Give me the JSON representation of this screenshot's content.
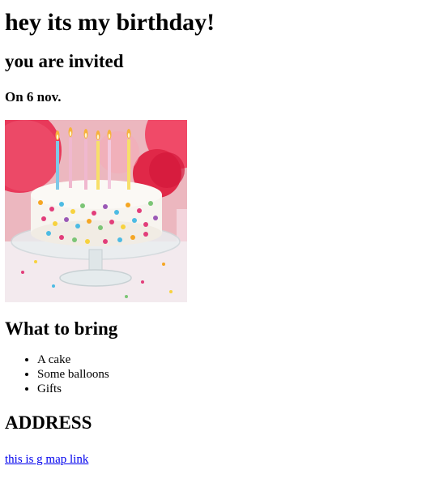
{
  "header": {
    "title": "hey its my birthday!",
    "subtitle": "you are invited",
    "date_line": "On 6 nov."
  },
  "image": {
    "name": "birthday-cake-with-candles"
  },
  "bring": {
    "heading": "What to bring",
    "items": [
      "A cake",
      "Some balloons",
      "Gifts"
    ]
  },
  "address": {
    "heading": "ADDRESS",
    "link_text": "this is g map link"
  },
  "colors": {
    "link": "#0000ee",
    "text": "#000000",
    "background": "#ffffff"
  }
}
